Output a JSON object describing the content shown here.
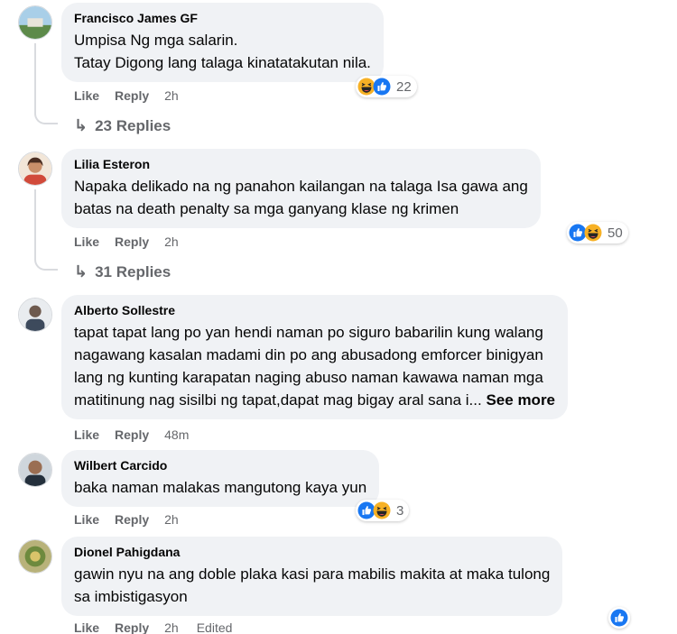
{
  "comments": [
    {
      "author": "Francisco James GF",
      "lines": [
        "Umpisa Ng mga salarin.",
        "Tatay Digong lang talaga kinatatakutan nila."
      ],
      "like": "Like",
      "reply": "Reply",
      "time": "2h",
      "reactions": [
        "haha",
        "like"
      ],
      "reaction_count": "22",
      "replies": "23 Replies"
    },
    {
      "author": "Lilia Esteron",
      "lines": [
        "Napaka delikado na ng panahon kailangan na talaga Isa gawa ang",
        "batas na death penalty sa mga ganyang klase ng krimen"
      ],
      "like": "Like",
      "reply": "Reply",
      "time": "2h",
      "reactions": [
        "like",
        "haha"
      ],
      "reaction_count": "50",
      "replies": "31 Replies"
    },
    {
      "author": "Alberto Sollestre",
      "lines": [
        "tapat tapat lang po yan hendi naman po siguro babarilin kung walang",
        "nagawang kasalan madami din po ang abusadong emforcer binigyan",
        "lang ng kunting karapatan naging abuso naman kawawa naman mga",
        "matitinung nag sisilbi ng tapat,dapat mag bigay aral sana i..."
      ],
      "see_more": "See more",
      "like": "Like",
      "reply": "Reply",
      "time": "48m"
    },
    {
      "author": "Wilbert Carcido",
      "lines": [
        "baka naman malakas mangutong kaya yun"
      ],
      "like": "Like",
      "reply": "Reply",
      "time": "2h",
      "reactions": [
        "like",
        "haha"
      ],
      "reaction_count": "3"
    },
    {
      "author": "Dionel Pahigdana",
      "lines": [
        "gawin nyu na ang doble plaka kasi para mabilis makita at maka tulong",
        "sa imbistigasyon"
      ],
      "like": "Like",
      "reply": "Reply",
      "time": "2h",
      "edited": "Edited",
      "reactions": [
        "like"
      ]
    }
  ],
  "colors": {
    "bubble": "#f0f2f5",
    "secondary_text": "#65676b",
    "like_blue": "#1877f2",
    "haha_yellow": "#f7b125"
  }
}
